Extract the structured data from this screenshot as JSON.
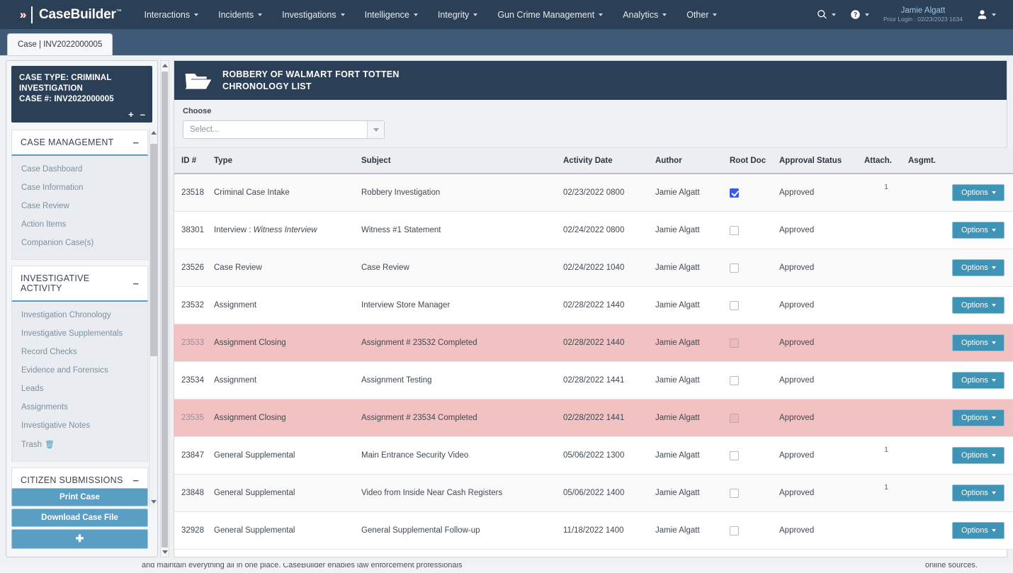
{
  "topnav": {
    "brand": "CaseBuilder",
    "brand_tm": "™",
    "menu": [
      {
        "label": "Interactions"
      },
      {
        "label": "Incidents"
      },
      {
        "label": "Investigations"
      },
      {
        "label": "Intelligence"
      },
      {
        "label": "Integrity"
      },
      {
        "label": "Gun Crime Management"
      },
      {
        "label": "Analytics"
      },
      {
        "label": "Other"
      }
    ],
    "user_name": "Jamie Algatt",
    "prior_login": "Prior Login : 02/23/2023 1634"
  },
  "tab": {
    "label": "Case | INV2022000005"
  },
  "sidebar": {
    "case_type": "CASE TYPE: CRIMINAL",
    "case_type_2": "INVESTIGATION",
    "case_number": "CASE #: INV2022000005",
    "expand": "+",
    "collapse": "–",
    "sections": [
      {
        "title": "CASE MANAGEMENT",
        "toggle": "–",
        "items": [
          {
            "label": "Case Dashboard"
          },
          {
            "label": "Case Information"
          },
          {
            "label": "Case Review"
          },
          {
            "label": "Action Items"
          },
          {
            "label": "Companion Case(s)"
          }
        ]
      },
      {
        "title": "INVESTIGATIVE ACTIVITY",
        "toggle": "–",
        "items": [
          {
            "label": "Investigation Chronology"
          },
          {
            "label": "Investigative Supplementals"
          },
          {
            "label": "Record Checks"
          },
          {
            "label": "Evidence and Forensics"
          },
          {
            "label": "Leads"
          },
          {
            "label": "Assignments"
          },
          {
            "label": "Investigative Notes"
          },
          {
            "label": "Trash",
            "icon": "trash-icon"
          }
        ]
      },
      {
        "title": "CITIZEN SUBMISSIONS",
        "toggle": "–",
        "items": []
      }
    ],
    "buttons": {
      "print": "Print Case",
      "download": "Download Case File",
      "add": "✚"
    }
  },
  "main": {
    "header_line1": "ROBBERY OF WALMART FORT TOTTEN",
    "header_line2": "CHRONOLOGY LIST",
    "choose_label": "Choose",
    "select_value": "Select...",
    "columns": [
      "ID #",
      "Type",
      "Subject",
      "Activity Date",
      "Author",
      "Root Doc",
      "Approval Status",
      "Attach.",
      "Asgmt.",
      ""
    ],
    "options_label": "Options",
    "rows": [
      {
        "id": "23518",
        "type": "Criminal Case Intake",
        "type_italic": "",
        "subject": "Robbery Investigation",
        "date": "02/23/2022 0800",
        "author": "Jamie Algatt",
        "root_doc": true,
        "status": "Approved",
        "attach": "1",
        "asgmt": "",
        "flagged": false
      },
      {
        "id": "38301",
        "type": "Interview : ",
        "type_italic": "Witness Interview",
        "subject": "Witness #1 Statement",
        "date": "02/24/2022 0800",
        "author": "Jamie Algatt",
        "root_doc": false,
        "status": "Approved",
        "attach": "",
        "asgmt": "",
        "flagged": false
      },
      {
        "id": "23526",
        "type": "Case Review",
        "type_italic": "",
        "subject": "Case Review",
        "date": "02/24/2022 1040",
        "author": "Jamie Algatt",
        "root_doc": false,
        "status": "Approved",
        "attach": "",
        "asgmt": "",
        "flagged": false
      },
      {
        "id": "23532",
        "type": "Assignment",
        "type_italic": "",
        "subject": "Interview Store Manager",
        "date": "02/28/2022 1440",
        "author": "Jamie Algatt",
        "root_doc": false,
        "status": "Approved",
        "attach": "",
        "asgmt": "",
        "flagged": false
      },
      {
        "id": "23533",
        "type": "Assignment Closing",
        "type_italic": "",
        "subject": "Assignment # 23532 Completed",
        "date": "02/28/2022 1440",
        "author": "Jamie Algatt",
        "root_doc": false,
        "status": "Approved",
        "attach": "",
        "asgmt": "",
        "flagged": true
      },
      {
        "id": "23534",
        "type": "Assignment",
        "type_italic": "",
        "subject": "Assignment Testing",
        "date": "02/28/2022 1441",
        "author": "Jamie Algatt",
        "root_doc": false,
        "status": "Approved",
        "attach": "",
        "asgmt": "",
        "flagged": false
      },
      {
        "id": "23535",
        "type": "Assignment Closing",
        "type_italic": "",
        "subject": "Assignment # 23534 Completed",
        "date": "02/28/2022 1441",
        "author": "Jamie Algatt",
        "root_doc": false,
        "status": "Approved",
        "attach": "",
        "asgmt": "",
        "flagged": true
      },
      {
        "id": "23847",
        "type": "General Supplemental",
        "type_italic": "",
        "subject": "Main Entrance Security Video",
        "date": "05/06/2022 1300",
        "author": "Jamie Algatt",
        "root_doc": false,
        "status": "Approved",
        "attach": "1",
        "asgmt": "",
        "flagged": false
      },
      {
        "id": "23848",
        "type": "General Supplemental",
        "type_italic": "",
        "subject": "Video from Inside Near Cash Registers",
        "date": "05/06/2022 1400",
        "author": "Jamie Algatt",
        "root_doc": false,
        "status": "Approved",
        "attach": "1",
        "asgmt": "",
        "flagged": false
      },
      {
        "id": "32928",
        "type": "General Supplemental",
        "type_italic": "",
        "subject": "General Supplemental Follow-up",
        "date": "11/18/2022 1400",
        "author": "Jamie Algatt",
        "root_doc": false,
        "status": "Approved",
        "attach": "",
        "asgmt": "",
        "flagged": false
      }
    ]
  },
  "footer": {
    "text": "and maintain everything all in one place. CaseBuilder enables law enforcement professionals",
    "right_text": "online sources."
  },
  "colors": {
    "navy": "#2b3f56",
    "tabstrip": "#3f5a78",
    "accent_blue": "#5b9ec4",
    "options_blue": "#3f93b5",
    "flag_row": "#f2c1c1",
    "link_gray": "#7d909e",
    "id_blue": "#7aa6c2"
  }
}
